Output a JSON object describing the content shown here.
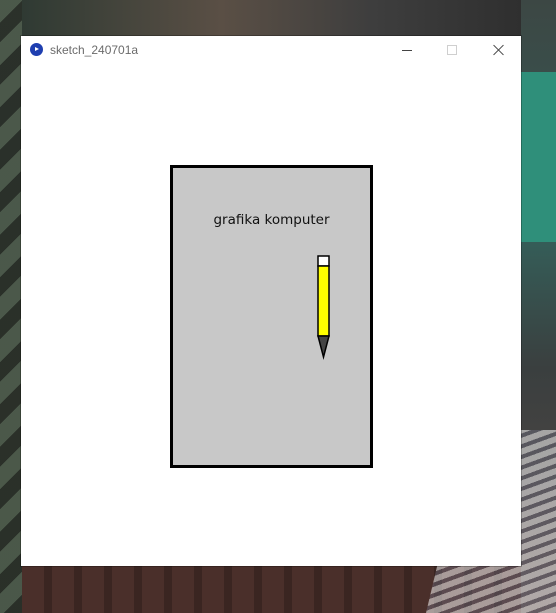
{
  "window": {
    "title": "sketch_240701a",
    "controls": {
      "minimize_icon": "minimize-icon",
      "maximize_icon": "maximize-icon",
      "close_icon": "close-icon"
    }
  },
  "sketch": {
    "book_text": "grafika komputer"
  },
  "colors": {
    "book_fill": "#c8c8c8",
    "book_stroke": "#000000",
    "pencil_body": "#ffff00",
    "pencil_eraser": "#ffffff",
    "pencil_tip": "#444444",
    "app_icon": "#1f3fb0"
  }
}
